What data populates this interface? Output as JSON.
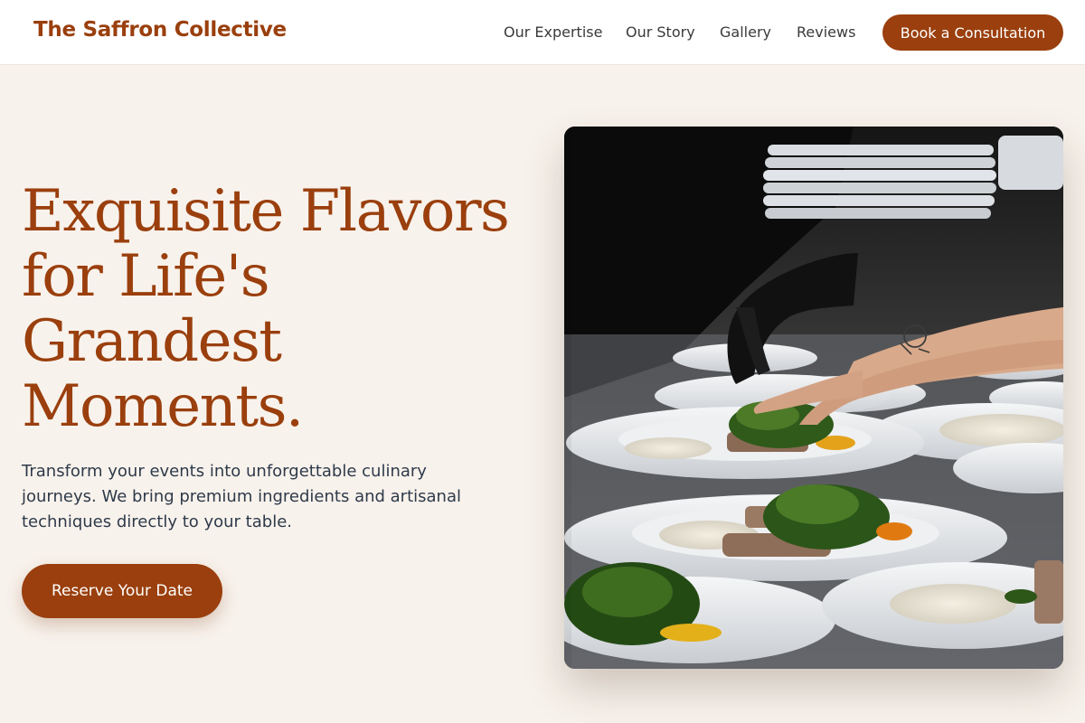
{
  "header": {
    "brand": "The Saffron Collective",
    "nav": [
      "Our Expertise",
      "Our Story",
      "Gallery",
      "Reviews"
    ],
    "cta": "Book a Consultation"
  },
  "hero": {
    "title_lines": [
      "Exquisite Flavors",
      "for Life's",
      "Grandest",
      "Moments."
    ],
    "subtitle_lines": [
      "Transform your events into unforgettable culinary",
      "journeys. We bring premium ingredients and artisanal",
      "techniques directly to your table."
    ],
    "cta": "Reserve Your Date"
  },
  "colors": {
    "accent": "#9a3f0d",
    "background": "#f8f2ec",
    "text": "#2e3a4a"
  },
  "image": {
    "subject": "chef plating dishes with gloved hands"
  }
}
